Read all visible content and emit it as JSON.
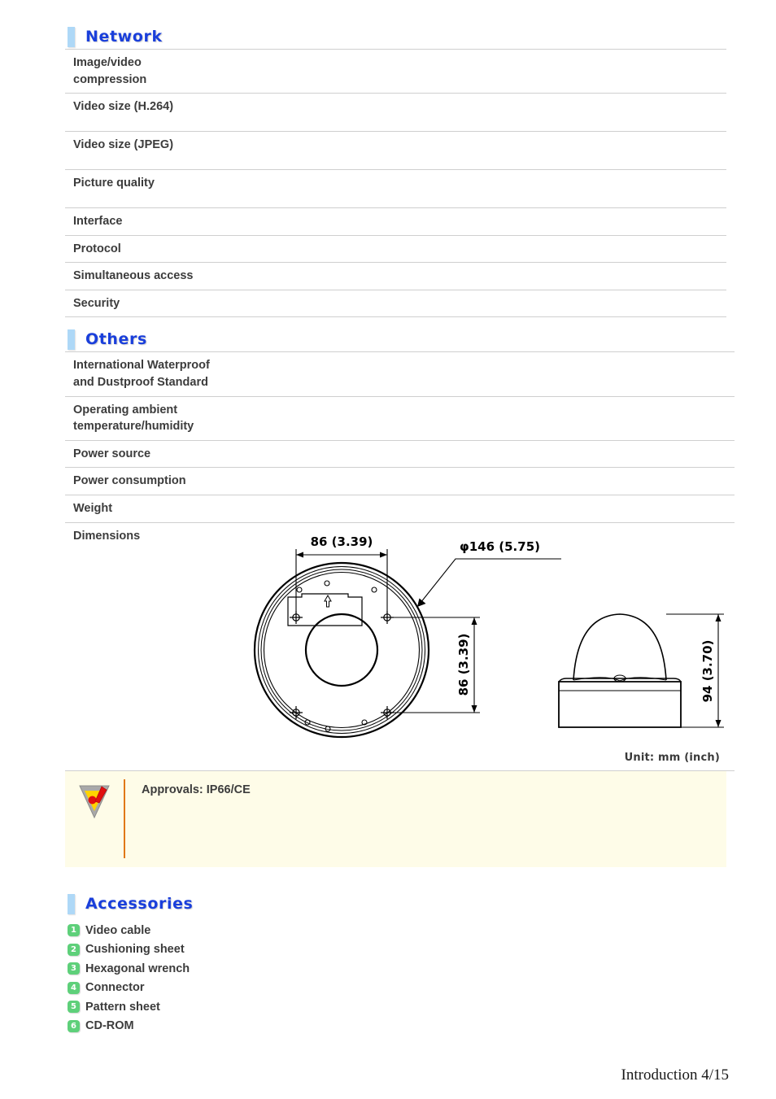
{
  "sections": [
    {
      "id": "network",
      "title": "Network",
      "rows": [
        {
          "label": "Image/video\ncompression",
          "value": "",
          "height": "tall"
        },
        {
          "label": "Video size (H.264)",
          "value": "",
          "height": "tall"
        },
        {
          "label": "Video size (JPEG)",
          "value": "",
          "height": "tall"
        },
        {
          "label": "Picture quality",
          "value": "",
          "height": "tall"
        },
        {
          "label": "Interface",
          "value": "",
          "height": "short"
        },
        {
          "label": "Protocol",
          "value": "",
          "height": "short"
        },
        {
          "label": "Simultaneous access",
          "value": "",
          "height": "short"
        },
        {
          "label": "Security",
          "value": "",
          "height": "short"
        }
      ]
    },
    {
      "id": "others",
      "title": "Others",
      "rows": [
        {
          "label": "International Waterproof\nand Dustproof Standard",
          "value": "",
          "height": "tall"
        },
        {
          "label": "Operating ambient\ntemperature/humidity",
          "value": "",
          "height": "tall"
        },
        {
          "label": "Power source",
          "value": "",
          "height": "short"
        },
        {
          "label": "Power consumption",
          "value": "",
          "height": "short"
        },
        {
          "label": "Weight",
          "value": "",
          "height": "short"
        },
        {
          "label": "Dimensions",
          "value": "",
          "height": "drawing"
        }
      ]
    }
  ],
  "drawing": {
    "unit_label": "Unit: mm (inch)",
    "dim_top_width": "86 (3.39)",
    "dim_diameter": "φ146 (5.75)",
    "dim_right_height": "86 (3.39)",
    "dim_side_height": "94 (3.70)",
    "views": [
      "bottom-view-circular-base",
      "side-view-dome"
    ]
  },
  "note": {
    "icon": "caution-triangle-icon",
    "text": "Approvals: IP66/CE",
    "background": "#fefce8",
    "divider_color": "#e07818"
  },
  "accessories": {
    "title": "Accessories",
    "items": [
      {
        "num": "1",
        "label": "Video cable"
      },
      {
        "num": "2",
        "label": "Cushioning sheet"
      },
      {
        "num": "3",
        "label": "Hexagonal wrench"
      },
      {
        "num": "4",
        "label": "Connector"
      },
      {
        "num": "5",
        "label": "Pattern sheet"
      },
      {
        "num": "6",
        "label": "CD-ROM"
      }
    ],
    "badge_color": "#5ed07a"
  },
  "footer": {
    "text": "Introduction 4/15"
  },
  "theme": {
    "heading_color": "#1a3fdb",
    "heading_bar_color": "#aed8f7",
    "rule_color": "#cfcfcf",
    "text_color": "#3c3c3c"
  }
}
